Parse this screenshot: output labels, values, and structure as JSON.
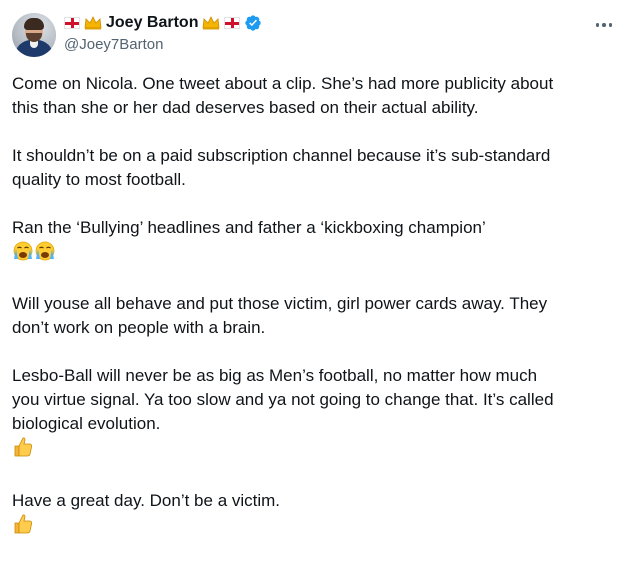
{
  "author": {
    "name": "Joey Barton",
    "handle": "@Joey7Barton",
    "verified": true,
    "name_prefix_icons": [
      "england-flag-icon",
      "crown-icon"
    ],
    "name_suffix_icons": [
      "crown-icon",
      "england-flag-icon"
    ]
  },
  "menu": {
    "icon": "more-options-icon"
  },
  "tweet": {
    "paragraphs": [
      {
        "text": "Come on Nicola. One tweet about a clip. She’s had more publicity about\nthis than she or her dad deserves based on their actual ability.",
        "emojis": []
      },
      {
        "text": "It shouldn’t be on a paid subscription channel because it’s sub-standard\nquality to most football.",
        "emojis": []
      },
      {
        "text": "Ran the ‘Bullying’ headlines and father a ‘kickboxing champion’",
        "emojis": [
          "crying-face-icon",
          "crying-face-icon"
        ]
      },
      {
        "text": "Will youse all behave and put those victim, girl power cards away. They\ndon’t work on people with a brain.",
        "emojis": []
      },
      {
        "text": "Lesbo-Ball will never be as big as Men’s football, no matter how much\nyou virtue signal. Ya too slow and ya not going to change that. It’s called\nbiological evolution.",
        "emojis": [
          "thumbs-up-icon"
        ]
      },
      {
        "text": "Have a great day. Don’t be a victim.",
        "emojis": [
          "thumbs-up-icon"
        ]
      }
    ]
  },
  "colors": {
    "text": "#0f1419",
    "secondary": "#536471",
    "verified_blue": "#1d9bf0",
    "flag_red": "#d0102a",
    "crown_gold": "#f4b400"
  }
}
